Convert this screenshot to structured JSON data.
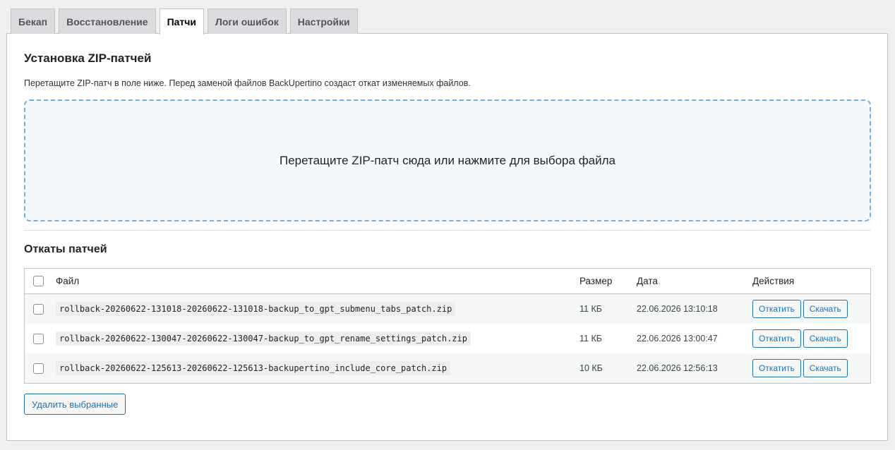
{
  "tabs": [
    {
      "label": "Бекап",
      "active": false
    },
    {
      "label": "Восстановление",
      "active": false
    },
    {
      "label": "Патчи",
      "active": true
    },
    {
      "label": "Логи ошибок",
      "active": false
    },
    {
      "label": "Настройки",
      "active": false
    }
  ],
  "install": {
    "title": "Установка ZIP-патчей",
    "description": "Перетащите ZIP-патч в поле ниже. Перед заменой файлов BackUpertino создаст откат изменяемых файлов.",
    "dropzone_text": "Перетащите ZIP-патч сюда или нажмите для выбора файла"
  },
  "rollbacks": {
    "title": "Откаты патчей",
    "columns": {
      "file": "Файл",
      "size": "Размер",
      "date": "Дата",
      "actions": "Действия"
    },
    "rows": [
      {
        "file": "rollback-20260622-131018-20260622-131018-backup_to_gpt_submenu_tabs_patch.zip",
        "size": "11 КБ",
        "date": "22.06.2026 13:10:18"
      },
      {
        "file": "rollback-20260622-130047-20260622-130047-backup_to_gpt_rename_settings_patch.zip",
        "size": "11 КБ",
        "date": "22.06.2026 13:00:47"
      },
      {
        "file": "rollback-20260622-125613-20260622-125613-backupertino_include_core_patch.zip",
        "size": "10 КБ",
        "date": "22.06.2026 12:56:13"
      }
    ],
    "rollback_label": "Откатить",
    "download_label": "Скачать",
    "delete_selected_label": "Удалить выбранные"
  },
  "colors": {
    "accent": "#2271b1",
    "dropzone_border": "#72aee6"
  }
}
